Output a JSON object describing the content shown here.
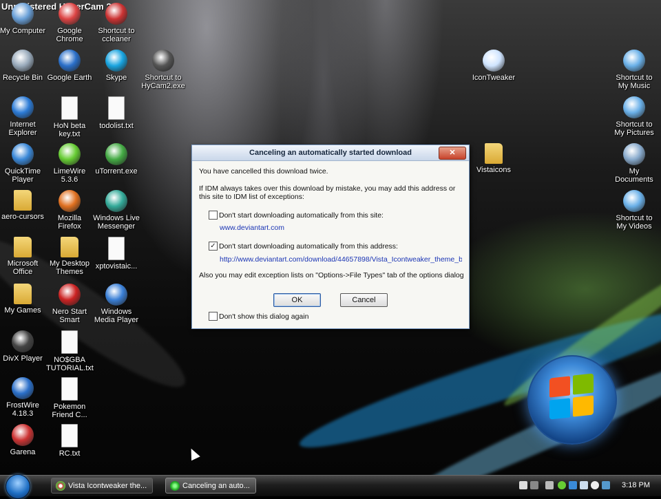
{
  "watermark": "Unregistered HyperCam 2",
  "desktop_icons": [
    {
      "label": "My Computer",
      "icon": "computer-icon",
      "color": "#6aa0d8"
    },
    {
      "label": "Google Chrome",
      "icon": "chrome-icon",
      "color": "#d44"
    },
    {
      "label": "Shortcut to ccleaner",
      "icon": "ccleaner-icon",
      "color": "#c33"
    },
    {
      "label": "Recycle Bin",
      "icon": "recycle-bin-icon",
      "color": "#9ab"
    },
    {
      "label": "Google Earth",
      "icon": "globe-icon",
      "color": "#2a6fc9"
    },
    {
      "label": "Skype",
      "icon": "skype-icon",
      "color": "#18a4e0"
    },
    {
      "label": "Shortcut to HyCam2.exe",
      "icon": "hypercam-icon",
      "color": "#555"
    },
    {
      "label": "IconTweaker",
      "icon": "icontweaker-icon",
      "color": "#cfe4ff"
    },
    {
      "label": "Shortcut to My Music",
      "icon": "music-folder-icon",
      "color": "#6ab0e8"
    },
    {
      "label": "Internet Explorer",
      "icon": "internet-explorer-icon",
      "color": "#2c7bd6"
    },
    {
      "label": "HoN beta key.txt",
      "icon": "text-file-icon",
      "color": "#fafafa"
    },
    {
      "label": "todolist.txt",
      "icon": "text-file-icon",
      "color": "#fafafa"
    },
    {
      "label": "Shortcut to My Pictures",
      "icon": "pictures-folder-icon",
      "color": "#6ab0e8"
    },
    {
      "label": "QuickTime Player",
      "icon": "quicktime-icon",
      "color": "#3a88d8"
    },
    {
      "label": "LimeWire 5.3.6",
      "icon": "limewire-icon",
      "color": "#6c3"
    },
    {
      "label": "uTorrent.exe",
      "icon": "utorrent-icon",
      "color": "#4a4"
    },
    {
      "label": "Vistaicons",
      "icon": "folder-icon",
      "color": "#e8c25a"
    },
    {
      "label": "My Documents",
      "icon": "documents-icon",
      "color": "#8ac"
    },
    {
      "label": "aero-cursors",
      "icon": "folder-icon",
      "color": "#e8c25a"
    },
    {
      "label": "Mozilla Firefox",
      "icon": "firefox-icon",
      "color": "#e07020"
    },
    {
      "label": "Windows Live Messenger",
      "icon": "messenger-icon",
      "color": "#3a9"
    },
    {
      "label": "Shortcut to My Videos",
      "icon": "videos-folder-icon",
      "color": "#6ab0e8"
    },
    {
      "label": "Microsoft Office",
      "icon": "folder-icon",
      "color": "#e8c25a"
    },
    {
      "label": "My Desktop Themes",
      "icon": "folder-icon",
      "color": "#e8c25a"
    },
    {
      "label": "xptovistaic...",
      "icon": "text-file-icon",
      "color": "#fafafa"
    },
    {
      "label": "My Games",
      "icon": "folder-icon",
      "color": "#e8c25a"
    },
    {
      "label": "Nero Start Smart",
      "icon": "nero-icon",
      "color": "#c22"
    },
    {
      "label": "Windows Media Player",
      "icon": "media-player-icon",
      "color": "#3a7fd6"
    },
    {
      "label": "DivX Player",
      "icon": "divx-icon",
      "color": "#444"
    },
    {
      "label": "NO$GBA TUTORIAL.txt",
      "icon": "text-file-icon",
      "color": "#fafafa"
    },
    {
      "label": "FrostWire 4.18.3",
      "icon": "frostwire-icon",
      "color": "#2a6fc9"
    },
    {
      "label": "Pokemon Friend C...",
      "icon": "document-icon",
      "color": "#fafafa"
    },
    {
      "label": "Garena",
      "icon": "garena-icon",
      "color": "#c33"
    },
    {
      "label": "RC.txt",
      "icon": "text-file-icon",
      "color": "#fafafa"
    }
  ],
  "dialog": {
    "title": "Canceling an automatically started download",
    "close": "✕",
    "line1": "You have cancelled this download twice.",
    "line2": "If IDM always takes over this download by mistake, you may add this address or this site to IDM list of exceptions:",
    "site_check_label": "Don't start downloading automatically from this site:",
    "site_checked": false,
    "site_url": "www.deviantart.com",
    "address_check_label": "Don't start downloading automatically from this address:",
    "address_checked": true,
    "check_mark": "✓",
    "address_url": "http://www.deviantart.com/download/44657898/Vista_Icontweaker_theme_b",
    "line3": "Also you may edit exception lists on \"Options->File Types\" tab of the options dialog",
    "ok_label": "OK",
    "cancel_label": "Cancel",
    "dont_show_label": "Don't show this dialog again",
    "dont_show_checked": false
  },
  "taskbar": {
    "buttons": [
      {
        "label": "Vista Icontweaker the...",
        "icon": "chrome-icon",
        "active": false
      },
      {
        "label": "Canceling an auto...",
        "icon": "idm-icon",
        "active": true
      }
    ],
    "clock": "3:18 PM"
  }
}
